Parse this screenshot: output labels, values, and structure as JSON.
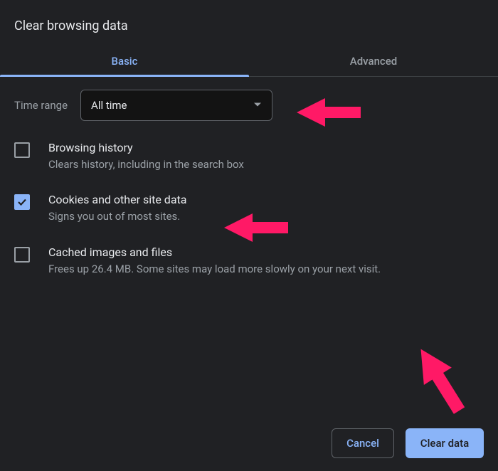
{
  "dialog_title": "Clear browsing data",
  "tabs": {
    "basic": "Basic",
    "advanced": "Advanced"
  },
  "time_range": {
    "label": "Time range",
    "selected": "All time"
  },
  "options": [
    {
      "title": "Browsing history",
      "description": "Clears history, including in the search box",
      "checked": false
    },
    {
      "title": "Cookies and other site data",
      "description": "Signs you out of most sites.",
      "checked": true
    },
    {
      "title": "Cached images and files",
      "description": "Frees up 26.4 MB. Some sites may load more slowly on your next visit.",
      "checked": false
    }
  ],
  "buttons": {
    "cancel": "Cancel",
    "clear": "Clear data"
  },
  "colors": {
    "accent": "#8ab4f8",
    "bg": "#202124",
    "annotation": "#ff1966"
  }
}
